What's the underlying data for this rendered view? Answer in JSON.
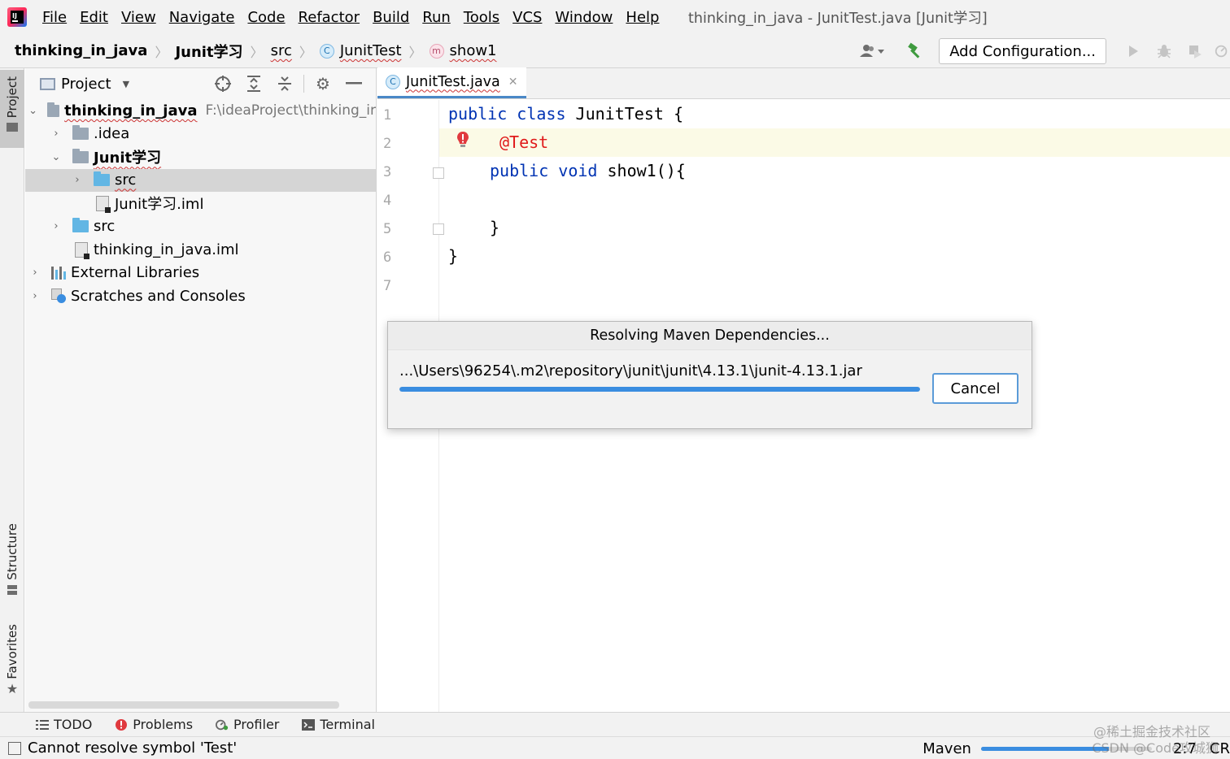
{
  "menubar": {
    "items": [
      {
        "label": "File"
      },
      {
        "label": "Edit"
      },
      {
        "label": "View"
      },
      {
        "label": "Navigate"
      },
      {
        "label": "Code"
      },
      {
        "label": "Refactor"
      },
      {
        "label": "Build"
      },
      {
        "label": "Run"
      },
      {
        "label": "Tools"
      },
      {
        "label": "VCS"
      },
      {
        "label": "Window"
      },
      {
        "label": "Help"
      }
    ],
    "window_title": "thinking_in_java - JunitTest.java [Junit学习]"
  },
  "breadcrumb": {
    "project": "thinking_in_java",
    "module": "Junit学习",
    "folder": "src",
    "class": "JunitTest",
    "method": "show1",
    "class_icon": "C",
    "method_icon": "m"
  },
  "toolbar": {
    "add_configuration": "Add Configuration..."
  },
  "left_strip": {
    "project_tab": "Project",
    "structure_tab": "Structure",
    "favorites_tab": "Favorites"
  },
  "project_panel": {
    "title": "Project",
    "tree": [
      {
        "label": "thinking_in_java",
        "hint": "F:\\ideaProject\\thinking_ir"
      },
      {
        "label": ".idea"
      },
      {
        "label": "Junit学习"
      },
      {
        "label": "src"
      },
      {
        "label": "Junit学习.iml"
      },
      {
        "label": "src"
      },
      {
        "label": "thinking_in_java.iml"
      },
      {
        "label": "External Libraries"
      },
      {
        "label": "Scratches and Consoles"
      }
    ]
  },
  "editor": {
    "tab_label": "JunitTest.java",
    "tab_icon": "C",
    "line_numbers": [
      "1",
      "2",
      "3",
      "4",
      "5",
      "6",
      "7"
    ],
    "code": {
      "l1_kw": "public class",
      "l1_rest": " JunitTest {",
      "l2_ann": "@Test",
      "l3_kw": "public void",
      "l3_rest": " show1(){",
      "l5": "}",
      "l6": "}"
    }
  },
  "dialog": {
    "title": "Resolving Maven Dependencies...",
    "path": "...\\Users\\96254\\.m2\\repository\\junit\\junit\\4.13.1\\junit-4.13.1.jar",
    "cancel_label": "Cancel",
    "progress": 1.0
  },
  "bottom_tools": {
    "todo": "TODO",
    "problems": "Problems",
    "profiler": "Profiler",
    "terminal": "Terminal"
  },
  "statusbar": {
    "message": "Cannot resolve symbol 'Test'",
    "maven": "Maven",
    "position": "2:7",
    "line_sep": "CR",
    "maven_progress": 0.75,
    "watermark1": "@稀土掘金技术社区",
    "watermark2": "CSDN @Code攻城狮"
  },
  "colors": {
    "keyword": "#0033b3",
    "error": "#e01a1a",
    "progress": "#3a8de0",
    "caret_row": "#fbfae6"
  }
}
